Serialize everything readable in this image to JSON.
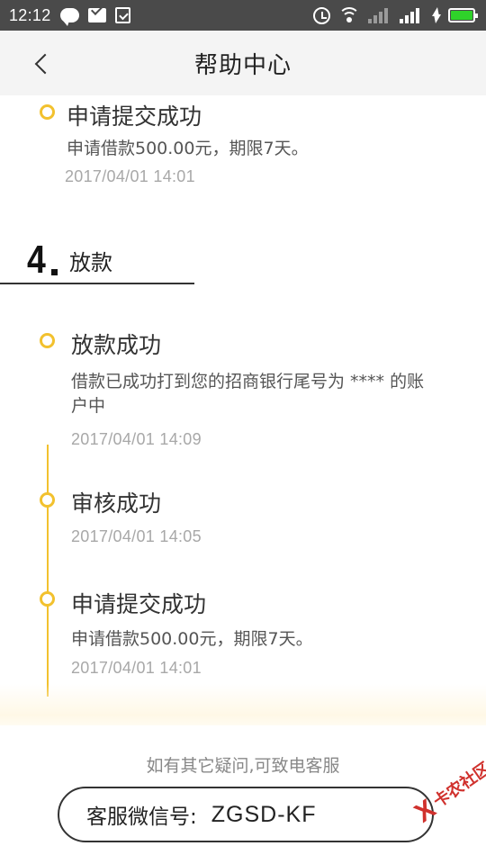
{
  "status_bar": {
    "time": "12:12",
    "battery_level": 1.0,
    "colors": {
      "background": "#4a4a4a",
      "battery": "#2fd22a"
    },
    "icons": [
      "chat-icon",
      "mail-icon",
      "shield-icon",
      "alarm-icon",
      "wifi-icon",
      "signal-4g-icon",
      "signal-icon",
      "charging-icon",
      "battery-icon"
    ]
  },
  "header": {
    "title": "帮助中心",
    "back_icon": "chevron-left-icon"
  },
  "timeline_top": {
    "title": "申请提交成功",
    "desc": "申请借款500.00元，期限7天。",
    "time": "2017/04/01 14:01"
  },
  "section": {
    "number": "4",
    "title": "放款"
  },
  "timeline": [
    {
      "title": "放款成功",
      "desc": "借款已成功打到您的招商银行尾号为 **** 的账户中",
      "time": "2017/04/01 14:09"
    },
    {
      "title": "审核成功",
      "desc": "",
      "time": "2017/04/01 14:05"
    },
    {
      "title": "申请提交成功",
      "desc": "申请借款500.00元，期限7天。",
      "time": "2017/04/01 14:01"
    }
  ],
  "footer": {
    "hint": "如有其它疑问,可致电客服",
    "wechat_label": "客服微信号:",
    "wechat_id": "ZGSD-KF"
  },
  "watermark": {
    "mark": "X",
    "text": "卡农社区"
  },
  "colors": {
    "accent": "#f2c12e",
    "nav_background": "#f4f4f4",
    "watermark": "#d0312d"
  }
}
